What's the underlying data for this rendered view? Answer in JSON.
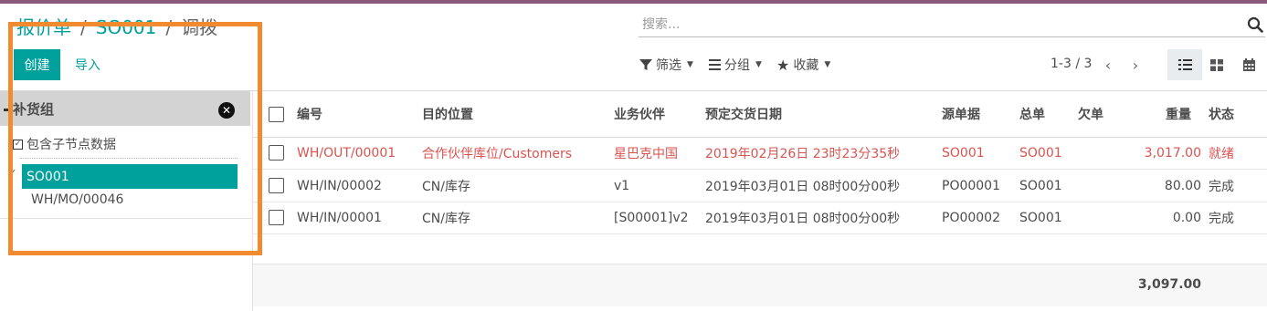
{
  "breadcrumb": {
    "part1": "报价单",
    "part2": "SO001",
    "active": "调拨"
  },
  "buttons": {
    "create": "创建",
    "import": "导入"
  },
  "search": {
    "placeholder": "搜索..."
  },
  "controls": {
    "filter": "筛选",
    "group": "分组",
    "favorite": "收藏"
  },
  "pager": {
    "text": "1-3 / 3"
  },
  "panel": {
    "title": "补货组",
    "include_subnodes": "包含子节点数据",
    "items": [
      "SO001",
      "WH/MO/00046"
    ]
  },
  "table": {
    "headers": {
      "ref": "编号",
      "dest": "目的位置",
      "partner": "业务伙伴",
      "date": "预定交货日期",
      "origin": "源单据",
      "group": "总单",
      "backorder": "欠单",
      "weight": "重量",
      "state": "状态"
    },
    "rows": [
      {
        "ref": "WH/OUT/00001",
        "dest": "合作伙伴库位/Customers",
        "partner": "星巴克中国",
        "date": "2019年02月26日 23时23分35秒",
        "origin": "SO001",
        "group": "SO001",
        "backorder": "",
        "weight": "3,017.00",
        "state": "就绪"
      },
      {
        "ref": "WH/IN/00002",
        "dest": "CN/库存",
        "partner": "v1",
        "date": "2019年03月01日 08时00分00秒",
        "origin": "PO00001",
        "group": "SO001",
        "backorder": "",
        "weight": "80.00",
        "state": "完成"
      },
      {
        "ref": "WH/IN/00001",
        "dest": "CN/库存",
        "partner": "[S00001]v2",
        "date": "2019年03月01日 08时00分00秒",
        "origin": "PO00002",
        "group": "SO001",
        "backorder": "",
        "weight": "0.00",
        "state": "完成"
      }
    ],
    "total_weight": "3,097.00"
  },
  "colors": {
    "brand": "#875a7b",
    "accent": "#00a09d",
    "highlight": "#f28b30",
    "late": "#d9534f"
  }
}
